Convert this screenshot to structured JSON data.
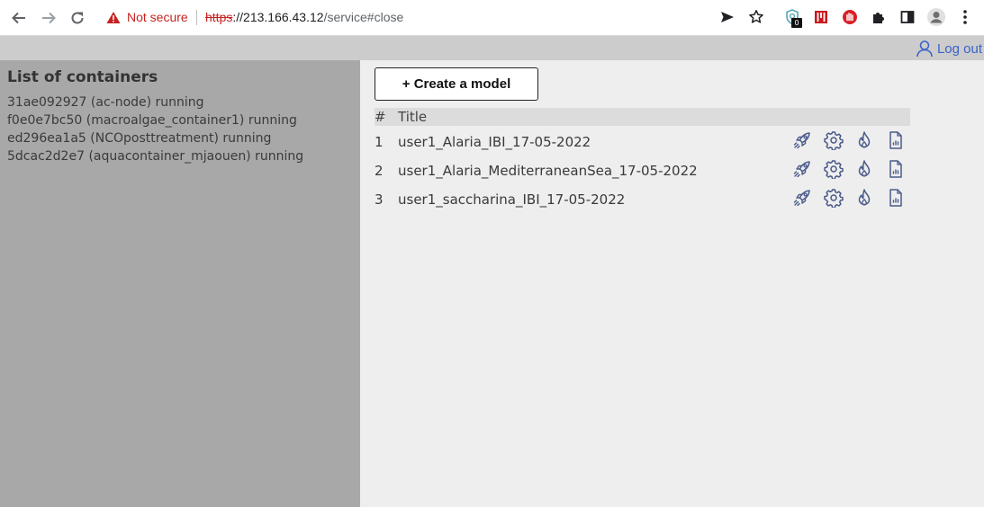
{
  "browser": {
    "security_label": "Not secure",
    "url_scheme": "https",
    "url_host": "://213.166.43.12",
    "url_path": "/service#close",
    "extension_badge": "0"
  },
  "header": {
    "logout_label": "Log out"
  },
  "containers": {
    "title": "List of containers",
    "items": [
      "31ae092927 (ac-node) running",
      "f0e0e7bc50 (macroalgae_container1) running",
      "ed296ea1a5 (NCOposttreatment) running",
      "5dcac2d2e7 (aquacontainer_mjaouen) running"
    ]
  },
  "models": {
    "create_label": "+ Create a model",
    "columns": {
      "num": "#",
      "title": "Title"
    },
    "rows": [
      {
        "num": "1",
        "title": "user1_Alaria_IBI_17-05-2022"
      },
      {
        "num": "2",
        "title": "user1_Alaria_MediterraneanSea_17-05-2022"
      },
      {
        "num": "3",
        "title": "user1_saccharina_IBI_17-05-2022"
      }
    ],
    "row_actions": [
      "rocket-icon",
      "gear-icon",
      "flame-icon",
      "report-icon"
    ]
  },
  "colors": {
    "accent": "#3b63c9",
    "icon": "#4a5a8a",
    "left_panel": "#a8a8a8",
    "right_panel": "#eeeeee",
    "header_strip": "#cccccc",
    "warning": "#c5221f"
  }
}
